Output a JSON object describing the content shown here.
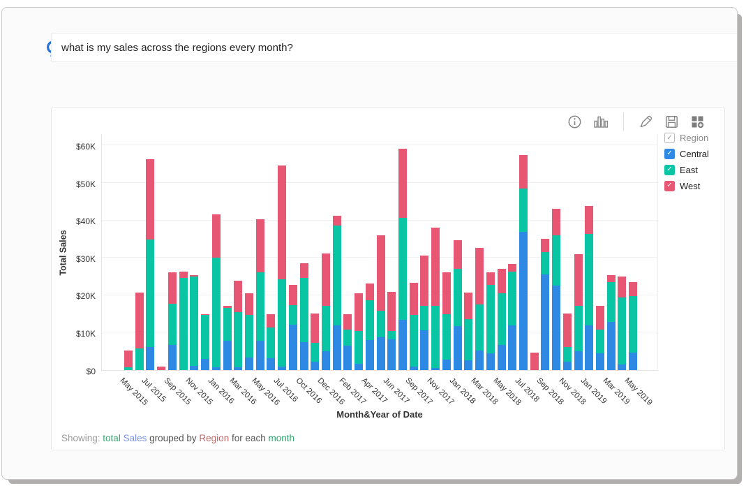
{
  "query_bar": {
    "query": "what is my sales across the regions every month?",
    "logo": "zia"
  },
  "toolbar": {
    "icons": [
      "info",
      "column-chart",
      "edit",
      "save",
      "add-to-dashboard"
    ]
  },
  "legend": {
    "header": {
      "label": "Region",
      "checked": true
    },
    "items": [
      {
        "label": "Central",
        "color": "#2e89e5",
        "checked": true
      },
      {
        "label": "East",
        "color": "#0ac5a4",
        "checked": true
      },
      {
        "label": "West",
        "color": "#e75672",
        "checked": true
      }
    ]
  },
  "chart_data": {
    "type": "bar",
    "stacked": true,
    "title": "",
    "xlabel": "Month&Year of Date",
    "ylabel": "Total Sales",
    "ylim": [
      0,
      60000
    ],
    "y_ticks": [
      "$0",
      "$10K",
      "$20K",
      "$30K",
      "$40K",
      "$50K",
      "$60K"
    ],
    "grid": true,
    "legend_position": "right",
    "series_names": [
      "Central",
      "East",
      "West"
    ],
    "series_colors": {
      "Central": "#2e89e5",
      "East": "#0ac5a4",
      "West": "#e75672"
    },
    "x_tick_labels": [
      "May 2015",
      "Jul 2015",
      "Sep 2015",
      "Nov 2015",
      "Jan 2016",
      "Mar 2016",
      "May 2016",
      "Jul 2016",
      "Oct 2016",
      "Dec 2016",
      "Feb 2017",
      "Apr 2017",
      "Jun 2017",
      "Sep 2017",
      "Nov 2017",
      "Jan 2018",
      "Mar 2018",
      "May 2018",
      "Jul 2018",
      "Sep 2018",
      "Nov 2018",
      "Jan 2019",
      "Mar 2019",
      "May 2019"
    ],
    "bars": [
      {
        "month": "May 2015",
        "Central": 0,
        "East": 700,
        "West": 4600
      },
      {
        "month": "Jun 2015",
        "Central": 0,
        "East": 5700,
        "West": 15100
      },
      {
        "month": "Jul 2015",
        "Central": 6200,
        "East": 28700,
        "West": 21500
      },
      {
        "month": "Aug 2015",
        "Central": 0,
        "East": 0,
        "West": 900
      },
      {
        "month": "Sep 2015",
        "Central": 6800,
        "East": 11000,
        "West": 8300
      },
      {
        "month": "Oct 2015",
        "Central": 0,
        "East": 24700,
        "West": 1600
      },
      {
        "month": "Nov 2015",
        "Central": 1100,
        "East": 23900,
        "West": 400
      },
      {
        "month": "Dec 2015",
        "Central": 3000,
        "East": 11800,
        "West": 200
      },
      {
        "month": "Jan 2016",
        "Central": 800,
        "East": 29200,
        "West": 11600
      },
      {
        "month": "Feb 2016",
        "Central": 7900,
        "East": 8700,
        "West": 500
      },
      {
        "month": "Mar 2016",
        "Central": 700,
        "East": 14800,
        "West": 8300
      },
      {
        "month": "Apr 2016",
        "Central": 3300,
        "East": 11400,
        "West": 5800
      },
      {
        "month": "May 2016",
        "Central": 7800,
        "East": 18300,
        "West": 14200
      },
      {
        "month": "Jun 2016",
        "Central": 3100,
        "East": 8200,
        "West": 3700
      },
      {
        "month": "Jul 2016",
        "Central": 900,
        "East": 23400,
        "West": 30300
      },
      {
        "month": "Aug 2016",
        "Central": 12200,
        "East": 5200,
        "West": 5300
      },
      {
        "month": "Oct 2016",
        "Central": 7500,
        "East": 17100,
        "West": 3900
      },
      {
        "month": "Nov 2016",
        "Central": 2200,
        "East": 5000,
        "West": 7900
      },
      {
        "month": "Dec 2016",
        "Central": 5000,
        "East": 12100,
        "West": 14000
      },
      {
        "month": "Jan 2017",
        "Central": 11900,
        "East": 26700,
        "West": 2700
      },
      {
        "month": "Feb 2017",
        "Central": 6600,
        "East": 4200,
        "West": 4200
      },
      {
        "month": "Mar 2017",
        "Central": 1600,
        "East": 8800,
        "West": 10200
      },
      {
        "month": "Apr 2017",
        "Central": 8000,
        "East": 10600,
        "West": 4600
      },
      {
        "month": "May 2017",
        "Central": 8700,
        "East": 7100,
        "West": 20300
      },
      {
        "month": "Jun 2017",
        "Central": 8300,
        "East": 2200,
        "West": 10400
      },
      {
        "month": "Jul 2017",
        "Central": 13400,
        "East": 27300,
        "West": 18400
      },
      {
        "month": "Sep 2017",
        "Central": 900,
        "East": 13900,
        "West": 8600
      },
      {
        "month": "Oct 2017",
        "Central": 10700,
        "East": 6400,
        "West": 13500
      },
      {
        "month": "Nov 2017",
        "Central": 500,
        "East": 16600,
        "West": 20900
      },
      {
        "month": "Dec 2017",
        "Central": 2900,
        "East": 12100,
        "West": 11200
      },
      {
        "month": "Jan 2018",
        "Central": 11800,
        "East": 15200,
        "West": 7800
      },
      {
        "month": "Feb 2018",
        "Central": 2600,
        "East": 11100,
        "West": 7000
      },
      {
        "month": "Mar 2018",
        "Central": 5300,
        "East": 12200,
        "West": 15200
      },
      {
        "month": "Apr 2018",
        "Central": 4500,
        "East": 18200,
        "West": 3500
      },
      {
        "month": "May 2018",
        "Central": 6700,
        "East": 13900,
        "West": 6400
      },
      {
        "month": "Jun 2018",
        "Central": 11900,
        "East": 14500,
        "West": 1900
      },
      {
        "month": "Jul 2018",
        "Central": 37000,
        "East": 11500,
        "West": 9000
      },
      {
        "month": "Aug 2018",
        "Central": 0,
        "East": 0,
        "West": 4700
      },
      {
        "month": "Sep 2018",
        "Central": 25500,
        "East": 6100,
        "West": 3500
      },
      {
        "month": "Oct 2018",
        "Central": 22500,
        "East": 13500,
        "West": 7100
      },
      {
        "month": "Nov 2018",
        "Central": 2200,
        "East": 4000,
        "West": 9000
      },
      {
        "month": "Dec 2018",
        "Central": 5000,
        "East": 12100,
        "West": 13800
      },
      {
        "month": "Jan 2019",
        "Central": 11900,
        "East": 24500,
        "West": 7500
      },
      {
        "month": "Feb 2019",
        "Central": 4400,
        "East": 6500,
        "West": 6200
      },
      {
        "month": "Mar 2019",
        "Central": 12800,
        "East": 10700,
        "West": 1900
      },
      {
        "month": "Apr 2019",
        "Central": 1500,
        "East": 18000,
        "West": 5600
      },
      {
        "month": "May 2019",
        "Central": 4700,
        "East": 15000,
        "West": 3900
      }
    ]
  },
  "footer": {
    "parts": [
      {
        "text": "Showing: ",
        "color": "#9a9a9a",
        "interactable": false
      },
      {
        "text": "total ",
        "color": "#36a871",
        "interactable": true
      },
      {
        "text": "Sales ",
        "color": "#7b93e8",
        "interactable": true
      },
      {
        "text": "grouped by ",
        "color": "#555555",
        "interactable": false
      },
      {
        "text": "Region ",
        "color": "#bf6967",
        "interactable": true
      },
      {
        "text": "for each ",
        "color": "#555555",
        "interactable": false
      },
      {
        "text": "month",
        "color": "#2fa76c",
        "interactable": true
      }
    ]
  }
}
